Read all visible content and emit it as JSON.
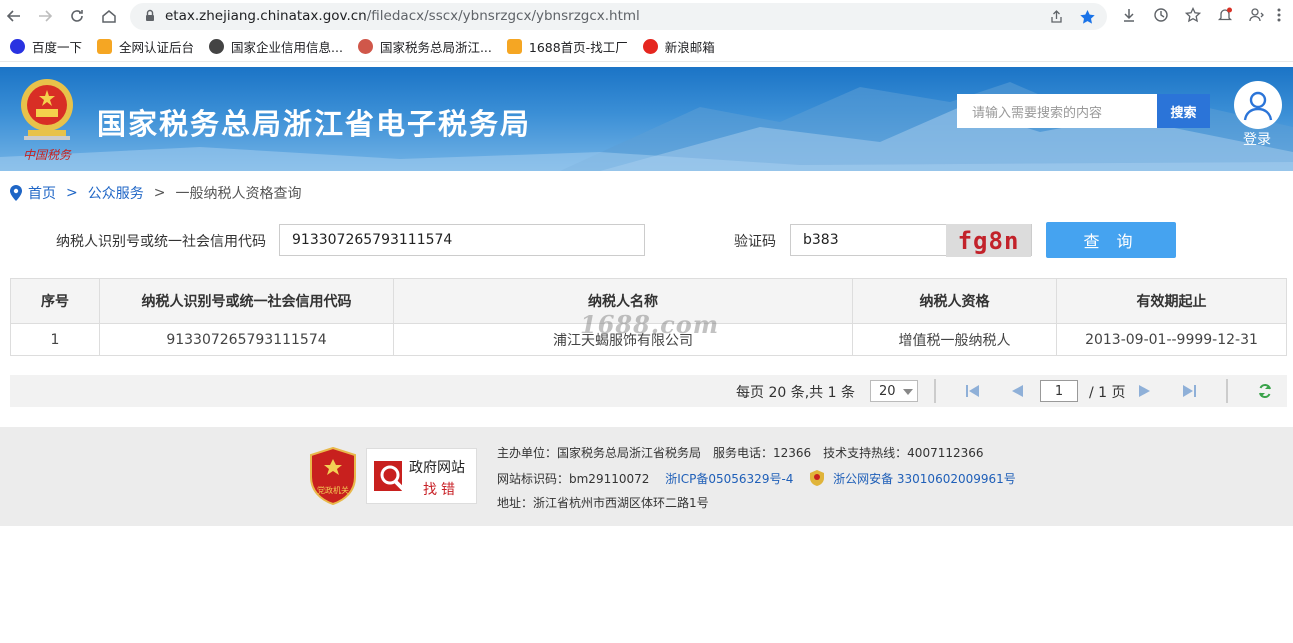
{
  "browser": {
    "url_host": "etax.zhejiang.chinatax.gov.cn",
    "url_path": "/filedacx/sscx/ybnsrzgcx/ybnsrzgcx.html",
    "bookmarks": [
      {
        "label": "百度一下",
        "color": "#2932e1"
      },
      {
        "label": "全网认证后台",
        "color": "#f5a623"
      },
      {
        "label": "国家企业信用信息...",
        "color": "#444444"
      },
      {
        "label": "国家税务总局浙江...",
        "color": "#d0574a"
      },
      {
        "label": "1688首页-找工厂",
        "color": "#f5a623"
      },
      {
        "label": "新浪邮箱",
        "color": "#e5261f"
      }
    ]
  },
  "header": {
    "site_title": "国家税务总局浙江省电子税务局",
    "search_placeholder": "请输入需要搜索的内容",
    "search_button": "搜索",
    "login_label": "登录"
  },
  "breadcrumb": {
    "home": "首页",
    "sep1": ">",
    "public_service": "公众服务",
    "sep2": ">",
    "current": "一般纳税人资格查询"
  },
  "form": {
    "taxpayer_id_label": "纳税人识别号或统一社会信用代码",
    "taxpayer_id_value": "913307265793111574",
    "captcha_label": "验证码",
    "captcha_value": "b383",
    "captcha_image_text": "fg8n",
    "query_button": "查 询"
  },
  "table": {
    "headers": [
      "序号",
      "纳税人识别号或统一社会信用代码",
      "纳税人名称",
      "纳税人资格",
      "有效期起止"
    ],
    "rows": [
      [
        "1",
        "913307265793111574",
        "浦江天蝎服饰有限公司",
        "增值税一般纳税人",
        "2013-09-01--9999-12-31"
      ]
    ]
  },
  "watermark": "1688.com",
  "pager": {
    "info": "每页 20 条,共 1 条",
    "page_size": "20",
    "current_page": "1",
    "total_pages": "/ 1 页"
  },
  "footer": {
    "badge_top": "政府网站",
    "badge_bottom": "找错",
    "shield_text": "党政机关",
    "line1": "主办单位：国家税务总局浙江省税务局　服务电话：12366　技术支持热线：4007112366",
    "site_code": "网站标识码：bm29110072",
    "icp": "浙ICP备05056329号-4",
    "police": "浙公网安备 33010602009961号",
    "address": "地址：浙江省杭州市西湖区体环二路1号"
  },
  "colors": {
    "accent_blue": "#1f66c6",
    "query_button": "#45a3f0",
    "header_blue": "#1b74c6"
  }
}
